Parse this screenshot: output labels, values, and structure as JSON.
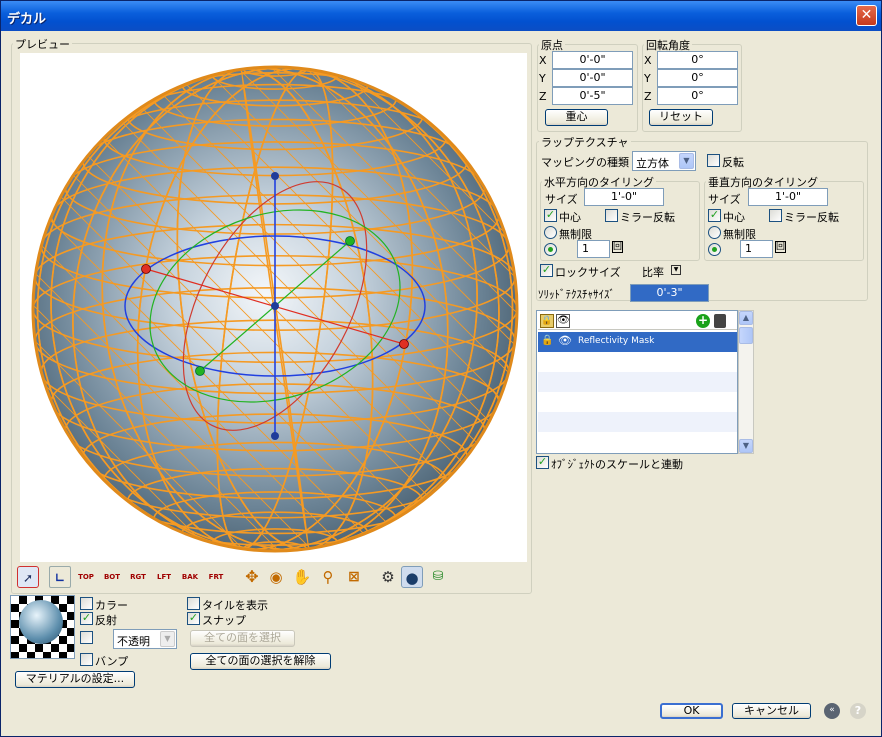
{
  "window": {
    "title": "デカル",
    "close_glyph": "✕"
  },
  "preview": {
    "label": "プレビュー"
  },
  "origin": {
    "label": "原点",
    "rows": [
      {
        "axis": "X",
        "value": "0'-0\""
      },
      {
        "axis": "Y",
        "value": "0'-0\""
      },
      {
        "axis": "Z",
        "value": "0'-5\""
      }
    ],
    "button": "重心"
  },
  "rotation": {
    "label": "回転角度",
    "rows": [
      {
        "axis": "X",
        "value": "0°"
      },
      {
        "axis": "Y",
        "value": "0°"
      },
      {
        "axis": "Z",
        "value": "0°"
      }
    ],
    "button": "リセット"
  },
  "wrap": {
    "label": "ラップテクスチャ",
    "mapping_label": "マッピングの種類",
    "mapping_value": "立方体",
    "flip_label": "反転",
    "horizontal": {
      "label": "水平方向のタイリング",
      "size_label": "サイズ",
      "size_value": "1'-0\"",
      "center_label": "中心",
      "mirror_label": "ミラー反転",
      "unlimited_label": "無制限",
      "count_value": "1",
      "count_unit": "回"
    },
    "vertical": {
      "label": "垂直方向のタイリング",
      "size_label": "サイズ",
      "size_value": "1'-0\"",
      "center_label": "中心",
      "mirror_label": "ミラー反転",
      "unlimited_label": "無制限",
      "count_value": "1",
      "count_unit": "回"
    },
    "lock_size_label": "ロックサイズ",
    "ratio_label": "比率",
    "solid_label": "ｿﾘｯﾄﾞﾃｸｽﾁｬｻｲｽﾞ",
    "solid_value": "0'-3\""
  },
  "layers": {
    "items": [
      {
        "name": "Reflectivity Mask"
      }
    ]
  },
  "link_scale_label": "ｵﾌﾞｼﾞｪｸﾄのスケールと連動",
  "toolbar": [
    "TOP",
    "BOT",
    "RGT",
    "LFT",
    "BAK",
    "FRT"
  ],
  "material": {
    "color_label": "カラー",
    "reflect_label": "反射",
    "opacity_value": "不透明",
    "bump_label": "バンプ",
    "settings_button": "マテリアルの設定..."
  },
  "tiles_label": "タイルを表示",
  "snap_label": "スナップ",
  "select_all_faces": "全ての面を選択",
  "deselect_all_faces": "全ての面の選択を解除",
  "ok_button": "OK",
  "cancel_button": "キャンセル",
  "colors": {
    "wire": "#f59a23",
    "title_bar": "#0a5fdc",
    "selection": "#316ac5"
  }
}
